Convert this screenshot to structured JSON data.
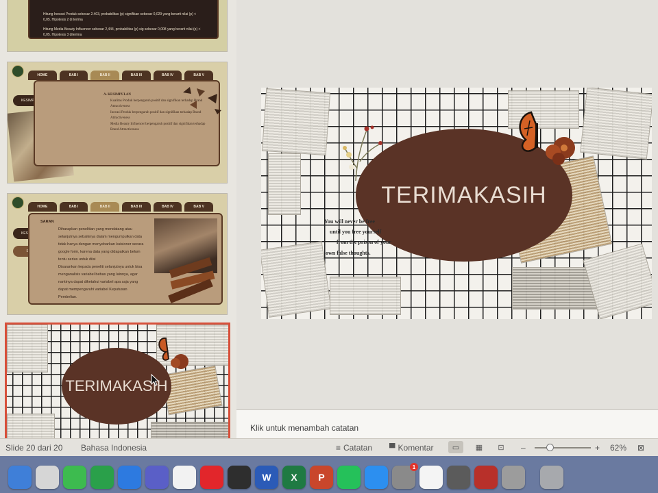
{
  "thumbnails": {
    "slide1_lines": [
      "Hitung Inovasi Produk sebesar 2.403, probabilitas (p) signifikan sebesar 0,029 yang berarti nilai (p) < 0,05. Hipotesis 2 di terima",
      "Hitung Media Beauty Influencer sebesar 2,444, probabilitas (p) sig sebesar 0,008 yang berarti nilai (p) < 0,05. Hipotesis 3 diterima"
    ],
    "tabs": [
      "HOME",
      "BAB I",
      "BAB II",
      "BAB III",
      "BAB IV",
      "BAB V"
    ],
    "side_buttons": [
      "KESIMPULAN",
      "SARAN"
    ],
    "slide2_heading": "A. KESIMPULAN",
    "slide2_items": [
      "Kualitas Produk berpengaruh positif dan signifikan terhadap Brand Attractiveness",
      "Inovasi Produk berpengaruh positif dan signifikan terhadap Brand Attractiveness",
      "Media Beauty Influencer berpengaruh positif dan signifikan terhadap Brand Attractiveness"
    ],
    "slide3_heading": "SARAN",
    "slide3_items": [
      "Diharapkan penelitian yang mendatang atau selanjutnya sebaiknya dalam mengumpulkan data tidak hanya dengan menyebarkan kuisioner secara google form, karena data yang didapatkan belum tentu serius untuk diisi",
      "Disarankan kepada peneliti selanjutnya untuk bisa menganalisis variabel bebas yang lainnya, agar nantinya dapat diketahui variabel apa saja yang dapat mempengaruhi variabel Keputusan Pembelian."
    ],
    "slide4_title": "TERIMAKASIH"
  },
  "slide": {
    "title": "TERIMAKASIH",
    "quote": [
      "You will never be free",
      "until you free yourself",
      "from the prison of your",
      "own false thoughts."
    ]
  },
  "notes": {
    "placeholder": "Klik untuk menambah catatan"
  },
  "statusbar": {
    "slide_info": "Slide 20 dari 20",
    "language": "Bahasa Indonesia",
    "notes_label": "Catatan",
    "comments_label": "Komentar",
    "zoom_minus": "–",
    "zoom_plus": "+",
    "zoom": "62%",
    "zoom_fraction": 0.27
  },
  "dock": {
    "items": [
      {
        "name": "finder-icon",
        "glyph": "",
        "color": "#3f7fd8"
      },
      {
        "name": "launchpad-icon",
        "glyph": "",
        "color": "#d6d6d6"
      },
      {
        "name": "messages-icon",
        "glyph": "",
        "color": "#3dbb4f"
      },
      {
        "name": "facetime-icon",
        "glyph": "",
        "color": "#2aa04a"
      },
      {
        "name": "safari-icon",
        "glyph": "",
        "color": "#2d7ae0"
      },
      {
        "name": "teams-icon",
        "glyph": "",
        "color": "#5a5fc7"
      },
      {
        "name": "chrome-icon",
        "glyph": "",
        "color": "#f2f2f2"
      },
      {
        "name": "opera-icon",
        "glyph": "",
        "color": "#e2262b"
      },
      {
        "name": "pen-tool-icon",
        "glyph": "",
        "color": "#2e2e2e"
      },
      {
        "name": "word-icon",
        "glyph": "W",
        "color": "#2b5bb7"
      },
      {
        "name": "excel-icon",
        "glyph": "X",
        "color": "#1f7a43"
      },
      {
        "name": "powerpoint-icon",
        "glyph": "P",
        "color": "#c9462b"
      },
      {
        "name": "whatsapp-icon",
        "glyph": "",
        "color": "#25c15a"
      },
      {
        "name": "app-store-icon",
        "glyph": "",
        "color": "#2c8ff0"
      },
      {
        "name": "system-preferences-icon",
        "glyph": "",
        "color": "#8a8a8a",
        "badge": "1"
      },
      {
        "name": "photos-icon",
        "glyph": "",
        "color": "#f4f4f4"
      },
      {
        "name": "preview-icon",
        "glyph": "",
        "color": "#5b5b5b"
      },
      {
        "name": "photo-booth-icon",
        "glyph": "",
        "color": "#b8302a"
      },
      {
        "name": "utilities-icon",
        "glyph": "",
        "color": "#9c9c9c"
      },
      {
        "name": "trash-icon",
        "glyph": "",
        "color": "#a7a9ad"
      }
    ]
  },
  "colors": {
    "oval": "#5a3326",
    "selection": "#d7503a",
    "card": "#b99c7c"
  }
}
